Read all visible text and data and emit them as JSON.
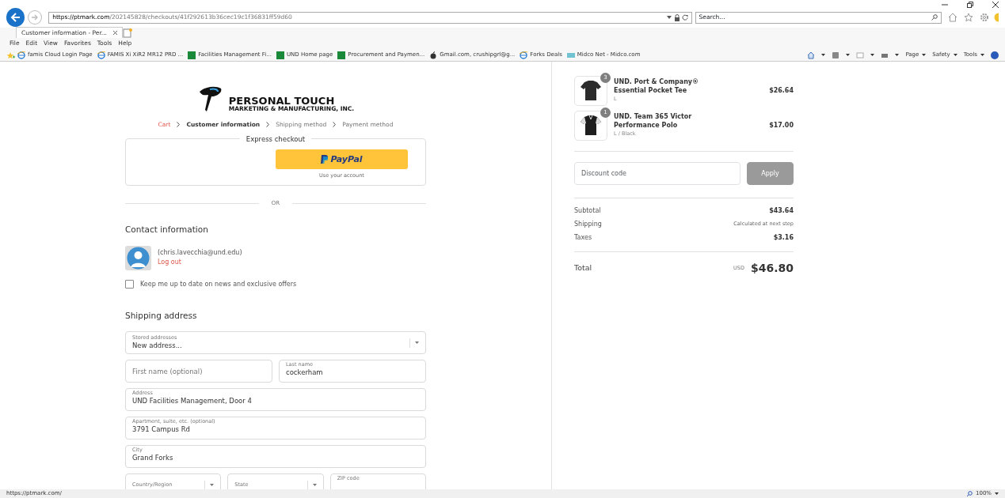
{
  "browser": {
    "url_host": "https://ptmark.com",
    "url_path": "/202145828/checkouts/41f292613b36cec19c1f36831ff59d60",
    "search_placeholder": "Search...",
    "tabs": [
      {
        "title": "Customer information - Per...",
        "selected": true
      }
    ],
    "menu": [
      "File",
      "Edit",
      "View",
      "Favorites",
      "Tools",
      "Help"
    ],
    "favorites": [
      {
        "label": "famis Cloud Login Page",
        "kind": "ie"
      },
      {
        "label": "FAMIS Xi XiR2 MR12 PRD ...",
        "kind": "ie"
      },
      {
        "label": "Facilities Management  Fi...",
        "kind": "und"
      },
      {
        "label": "UND Home page",
        "kind": "und"
      },
      {
        "label": "Procurement and Paymen...",
        "kind": "und"
      },
      {
        "label": "Gmail.com, crushipgrl@g...",
        "kind": "apple"
      },
      {
        "label": "Forks Deals",
        "kind": "ie"
      },
      {
        "label": "Midco Net - Midco.com",
        "kind": "midco"
      }
    ],
    "commands": [
      "Page",
      "Safety",
      "Tools"
    ],
    "status_url": "https://ptmark.com/",
    "zoom": "100%"
  },
  "logo": {
    "name": "PERSONAL TOUCH",
    "tagline": "MARKETING & MANUFACTURING, INC."
  },
  "breadcrumbs": [
    {
      "label": "Cart",
      "selected": false,
      "completed": true
    },
    {
      "label": "Customer information",
      "selected": true,
      "completed": false
    },
    {
      "label": "Shipping method",
      "selected": false,
      "completed": false
    },
    {
      "label": "Payment method",
      "selected": false,
      "completed": false
    }
  ],
  "express": {
    "title": "Express checkout",
    "button": "PayPal",
    "caption": "Use your account",
    "divider": "OR"
  },
  "contact": {
    "heading": "Contact information",
    "email": "(chris.lavecchia@und.edu)",
    "logout": "Log out",
    "newsletter": {
      "label": "Keep me up to date on news and exclusive offers",
      "checked": false
    }
  },
  "shipping": {
    "heading": "Shipping address",
    "rows": [
      [
        {
          "kind": "select",
          "label": "Stored addresses",
          "value": "New address..."
        }
      ],
      [
        {
          "kind": "input",
          "placeholder": "First name (optional)"
        },
        {
          "kind": "input",
          "label": "Last name",
          "value": "cockerham"
        }
      ],
      [
        {
          "kind": "input",
          "label": "Address",
          "value": "UND Facilities Management, Door 4"
        }
      ],
      [
        {
          "kind": "input",
          "label": "Apartment, suite, etc. (optional)",
          "value": "3791 Campus Rd"
        }
      ],
      [
        {
          "kind": "input",
          "label": "City",
          "value": "Grand Forks"
        }
      ],
      [
        {
          "kind": "select",
          "label": "Country/Region"
        },
        {
          "kind": "select",
          "label": "State"
        },
        {
          "kind": "input",
          "label": "ZIP code"
        }
      ]
    ]
  },
  "cart": {
    "items": [
      {
        "name": "UND. Port & Company® Essential Pocket Tee",
        "variant": "L",
        "quantity": "3",
        "price": "$26.64",
        "kind": "tee"
      },
      {
        "name": "UND. Team 365 Victor Performance Polo",
        "variant": "L / Black",
        "quantity": "1",
        "price": "$17.00",
        "kind": "polo"
      }
    ],
    "discount": {
      "placeholder": "Discount code",
      "button": "Apply",
      "disabled": true
    },
    "summary": [
      {
        "label": "Subtotal",
        "value": "$43.64",
        "kind": "amount"
      },
      {
        "label": "Shipping",
        "value": "Calculated at next step",
        "kind": "note"
      },
      {
        "label": "Taxes",
        "value": "$3.16",
        "kind": "amount"
      }
    ],
    "total": {
      "label": "Total",
      "currency": "USD",
      "value": "$46.80"
    }
  }
}
